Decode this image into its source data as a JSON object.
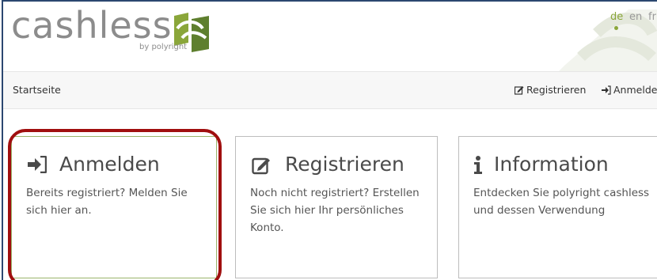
{
  "brand": {
    "name": "cashless",
    "sub": "by polyright"
  },
  "languages": [
    {
      "code": "de",
      "active": true
    },
    {
      "code": "en",
      "active": false
    },
    {
      "code": "fr",
      "active": false
    }
  ],
  "nav": {
    "home": "Startseite",
    "register": "Registrieren",
    "login": "Anmelden"
  },
  "cards": {
    "login": {
      "title": "Anmelden",
      "text": "Bereits registriert? Melden Sie sich hier an."
    },
    "register": {
      "title": "Registrieren",
      "text": "Noch nicht registriert? Erstellen Sie sich hier Ihr persönliches Konto."
    },
    "info": {
      "title": "Information",
      "text": "Entdecken Sie polyright cashless und dessen Verwendung"
    }
  },
  "colors": {
    "accent": "#8aa63a",
    "highlight": "#a00f0f",
    "frame": "#2b4770"
  },
  "icons": {
    "login": "sign-in-icon",
    "register": "edit-icon",
    "info": "info-icon"
  }
}
